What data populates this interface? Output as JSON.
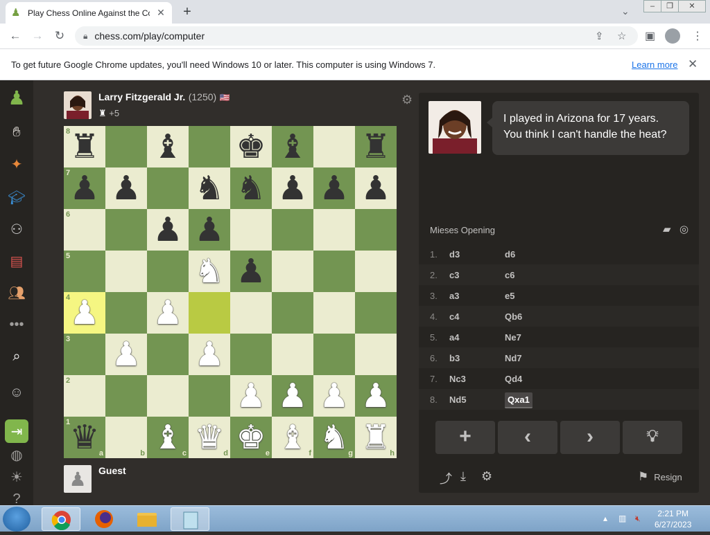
{
  "browser": {
    "tab_title": "Play Chess Online Against the Co",
    "url": "chess.com/play/computer",
    "infobar_message": "To get future Google Chrome updates, you'll need Windows 10 or later. This computer is using Windows 7.",
    "infobar_link": "Learn more"
  },
  "opponent": {
    "name": "Larry Fitzgerald Jr.",
    "rating": "(1250)",
    "advantage": "+5"
  },
  "player": {
    "name": "Guest"
  },
  "bot_message": "I played in Arizona for 17 years. You think I can't handle the heat?",
  "opening": "Mieses Opening",
  "moves": [
    {
      "num": "1.",
      "white": "d3",
      "black": "d6"
    },
    {
      "num": "2.",
      "white": "c3",
      "black": "c6"
    },
    {
      "num": "3.",
      "white": "a3",
      "black": "e5"
    },
    {
      "num": "4.",
      "white": "c4",
      "black": "Qb6"
    },
    {
      "num": "5.",
      "white": "a4",
      "black": "Ne7"
    },
    {
      "num": "6.",
      "white": "b3",
      "black": "Nd7"
    },
    {
      "num": "7.",
      "white": "Nc3",
      "black": "Qd4"
    },
    {
      "num": "8.",
      "white": "Nd5",
      "black": "Qxa1"
    }
  ],
  "controls": {
    "resign_label": "Resign"
  },
  "board": {
    "files": [
      "a",
      "b",
      "c",
      "d",
      "e",
      "f",
      "g",
      "h"
    ],
    "ranks": [
      "8",
      "7",
      "6",
      "5",
      "4",
      "3",
      "2",
      "1"
    ],
    "highlight": [
      "a4",
      "d4"
    ],
    "pieces": [
      {
        "sq": "a8",
        "p": "♜",
        "c": "b"
      },
      {
        "sq": "c8",
        "p": "♝",
        "c": "b"
      },
      {
        "sq": "e8",
        "p": "♚",
        "c": "b"
      },
      {
        "sq": "f8",
        "p": "♝",
        "c": "b"
      },
      {
        "sq": "h8",
        "p": "♜",
        "c": "b"
      },
      {
        "sq": "a7",
        "p": "♟",
        "c": "b"
      },
      {
        "sq": "b7",
        "p": "♟",
        "c": "b"
      },
      {
        "sq": "d7",
        "p": "♞",
        "c": "b"
      },
      {
        "sq": "e7",
        "p": "♞",
        "c": "b"
      },
      {
        "sq": "f7",
        "p": "♟",
        "c": "b"
      },
      {
        "sq": "g7",
        "p": "♟",
        "c": "b"
      },
      {
        "sq": "h7",
        "p": "♟",
        "c": "b"
      },
      {
        "sq": "c6",
        "p": "♟",
        "c": "b"
      },
      {
        "sq": "d6",
        "p": "♟",
        "c": "b"
      },
      {
        "sq": "d5",
        "p": "♞",
        "c": "w"
      },
      {
        "sq": "e5",
        "p": "♟",
        "c": "b"
      },
      {
        "sq": "a4",
        "p": "♟",
        "c": "w"
      },
      {
        "sq": "c4",
        "p": "♟",
        "c": "w"
      },
      {
        "sq": "b3",
        "p": "♟",
        "c": "w"
      },
      {
        "sq": "d3",
        "p": "♟",
        "c": "w"
      },
      {
        "sq": "e2",
        "p": "♟",
        "c": "w"
      },
      {
        "sq": "f2",
        "p": "♟",
        "c": "w"
      },
      {
        "sq": "g2",
        "p": "♟",
        "c": "w"
      },
      {
        "sq": "h2",
        "p": "♟",
        "c": "w"
      },
      {
        "sq": "a1",
        "p": "♛",
        "c": "b"
      },
      {
        "sq": "c1",
        "p": "♝",
        "c": "w"
      },
      {
        "sq": "d1",
        "p": "♛",
        "c": "w"
      },
      {
        "sq": "e1",
        "p": "♚",
        "c": "w"
      },
      {
        "sq": "f1",
        "p": "♝",
        "c": "w"
      },
      {
        "sq": "g1",
        "p": "♞",
        "c": "w"
      },
      {
        "sq": "h1",
        "p": "♜",
        "c": "w"
      }
    ]
  },
  "taskbar": {
    "time": "2:21 PM",
    "date": "6/27/2023"
  }
}
